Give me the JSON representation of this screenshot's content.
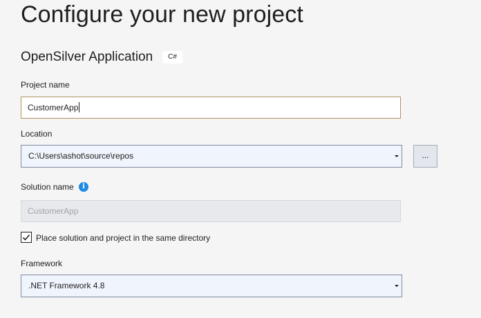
{
  "page": {
    "title": "Configure your new project"
  },
  "template": {
    "name": "OpenSilver Application",
    "language_tag": "C#"
  },
  "project_name": {
    "label": "Project name",
    "value": "CustomerApp"
  },
  "location": {
    "label": "Location",
    "value": "C:\\Users\\ashot\\source\\repos",
    "browse_label": "..."
  },
  "solution_name": {
    "label": "Solution name",
    "value": "CustomerApp",
    "enabled": false
  },
  "same_directory": {
    "label": "Place solution and project in the same directory",
    "checked": true
  },
  "framework": {
    "label": "Framework",
    "selected": ".NET Framework 4.8"
  },
  "colors": {
    "background": "#f5f5f5",
    "focus_border": "#b09160",
    "info_blue": "#1e8ae6",
    "combo_background": "#f0f4fc"
  },
  "icons": {
    "info": "info-icon",
    "dropdown": "chevron-down-icon",
    "check": "checkmark-icon"
  }
}
